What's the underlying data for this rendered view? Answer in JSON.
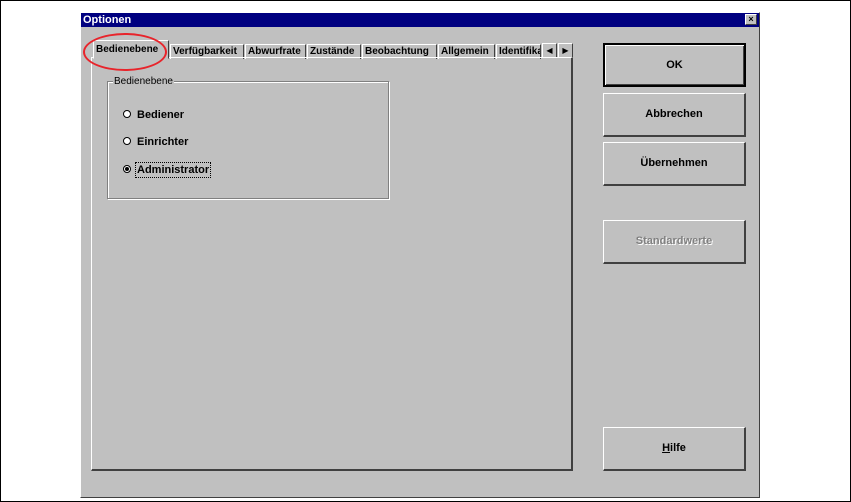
{
  "window": {
    "title": "Optionen",
    "close_glyph": "×"
  },
  "tabs": [
    {
      "label": "Bedienebene",
      "active": true
    },
    {
      "label": "Verfügbarkeit",
      "active": false
    },
    {
      "label": "Abwurfrate",
      "active": false
    },
    {
      "label": "Zustände",
      "active": false
    },
    {
      "label": "Beobachtung",
      "active": false
    },
    {
      "label": "Allgemein",
      "active": false
    },
    {
      "label": "Identifika",
      "active": false
    }
  ],
  "tab_scroll": {
    "left_icon": "◀",
    "right_icon": "▶"
  },
  "group": {
    "title": "Bedienebene",
    "options": [
      {
        "label": "Bediener",
        "selected": false
      },
      {
        "label": "Einrichter",
        "selected": false
      },
      {
        "label": "Administrator",
        "selected": true
      }
    ]
  },
  "buttons": {
    "ok": "OK",
    "cancel": "Abbrechen",
    "apply": "Übernehmen",
    "defaults": "Standardwerte",
    "help": "Hilfe"
  },
  "colors": {
    "titlebar": "#000080",
    "face": "#c0c0c0",
    "highlight_ring": "#e8242b"
  }
}
